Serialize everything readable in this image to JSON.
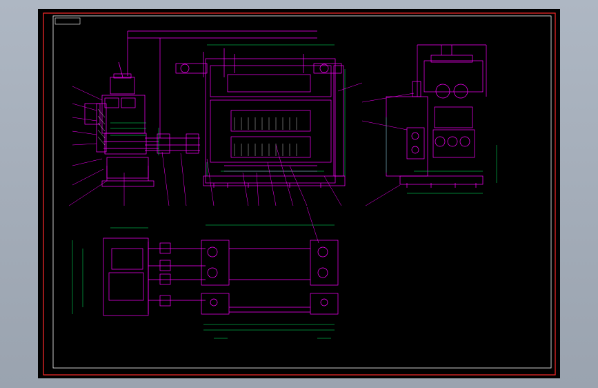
{
  "title_block": {
    "label": ""
  },
  "colors": {
    "background": "#000000",
    "border": "#ff2a2a",
    "frame": "#ffffff",
    "geometry": "#ff00ff",
    "dimension": "#00ff66",
    "hatch": "#ffffff"
  },
  "dimension_labels": [],
  "view_note": ""
}
